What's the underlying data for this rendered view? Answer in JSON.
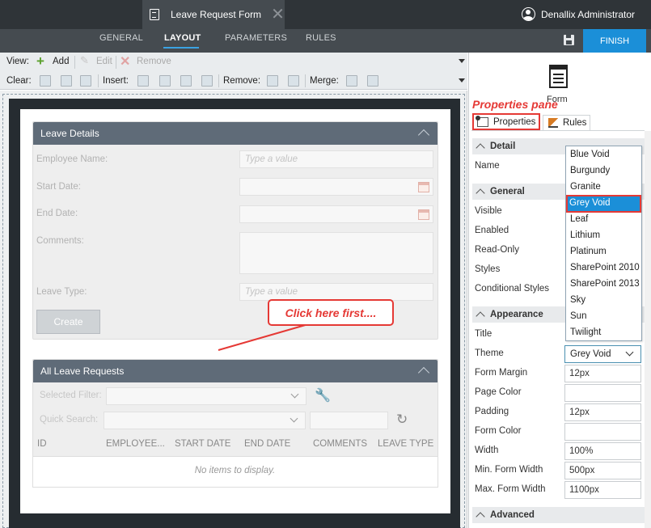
{
  "window": {
    "tab_title": "Leave Request Form",
    "user": "Denallix Administrator"
  },
  "nav": {
    "tabs": [
      "GENERAL",
      "LAYOUT",
      "PARAMETERS",
      "RULES"
    ],
    "active": "LAYOUT",
    "finish": "FINISH"
  },
  "toolbar": {
    "view_label": "View:",
    "add": "Add",
    "edit": "Edit",
    "remove": "Remove",
    "clear_label": "Clear:",
    "insert_label": "Insert:",
    "remove_label": "Remove:",
    "merge_label": "Merge:"
  },
  "leave_details": {
    "title": "Leave Details",
    "fields": [
      {
        "label": "Employee Name:",
        "placeholder": "Type a value"
      },
      {
        "label": "Start Date:",
        "placeholder": ""
      },
      {
        "label": "End Date:",
        "placeholder": ""
      },
      {
        "label": "Comments:",
        "placeholder": ""
      },
      {
        "label": "Leave Type:",
        "placeholder": "Type a value"
      }
    ],
    "create_button": "Create"
  },
  "all_requests": {
    "title": "All Leave Requests",
    "selected_filter": "Selected Filter:",
    "quick_search": "Quick Search:",
    "columns": [
      "ID",
      "EMPLOYEE...",
      "START DATE",
      "END DATE",
      "COMMENTS",
      "LEAVE TYPE"
    ],
    "empty": "No items to display."
  },
  "annotations": {
    "callout": "Click here first....",
    "properties_pane": "Properties pane"
  },
  "properties": {
    "form_label": "Form",
    "tabs": {
      "properties": "Properties",
      "rules": "Rules"
    },
    "sections": {
      "detail": "Detail",
      "general": "General",
      "appearance": "Appearance",
      "advanced": "Advanced"
    },
    "detail": [
      {
        "label": "Name"
      }
    ],
    "general": [
      {
        "label": "Visible"
      },
      {
        "label": "Enabled"
      },
      {
        "label": "Read-Only"
      },
      {
        "label": "Styles"
      },
      {
        "label": "Conditional Styles"
      }
    ],
    "appearance": [
      {
        "label": "Title",
        "value": ""
      },
      {
        "label": "Theme",
        "value": "Grey Void"
      },
      {
        "label": "Form Margin",
        "value": "12px"
      },
      {
        "label": "Page Color",
        "value": ""
      },
      {
        "label": "Padding",
        "value": "12px"
      },
      {
        "label": "Form Color",
        "value": ""
      },
      {
        "label": "Width",
        "value": "100%"
      },
      {
        "label": "Min. Form Width",
        "value": "500px"
      },
      {
        "label": "Max. Form Width",
        "value": "1100px"
      }
    ],
    "theme_options": [
      "Blue Void",
      "Burgundy",
      "Granite",
      "Grey Void",
      "Leaf",
      "Lithium",
      "Platinum",
      "SharePoint 2010",
      "SharePoint 2013",
      "Sky",
      "Sun",
      "Twilight"
    ],
    "theme_selected": "Grey Void"
  },
  "colors": {
    "accent": "#1b8fd8",
    "annotation": "#e53935",
    "panel_header": "#5f6b78",
    "topbar": "#2f3438"
  }
}
